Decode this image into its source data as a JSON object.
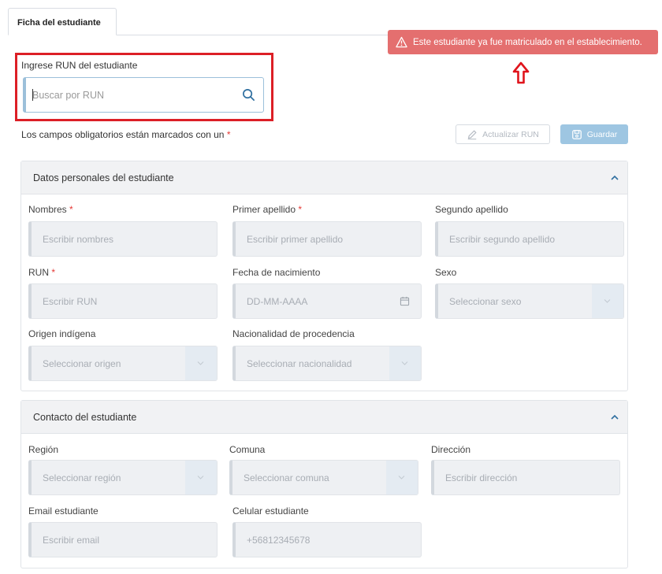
{
  "tab": {
    "label": "Ficha del estudiante"
  },
  "alert": {
    "message": "Este estudiante ya fue matriculado en el establecimiento."
  },
  "run_search": {
    "label": "Ingrese RUN del estudiante",
    "placeholder": "Buscar por RUN"
  },
  "required_note": {
    "text": "Los campos obligatorios están marcados con un",
    "asterisk": "*"
  },
  "actions": {
    "update_label": "Actualizar RUN",
    "save_label": "Guardar"
  },
  "personal": {
    "title": "Datos personales del estudiante",
    "nombres": {
      "label": "Nombres",
      "placeholder": "Escribir nombres"
    },
    "primer_apellido": {
      "label": "Primer apellido",
      "placeholder": "Escribir primer apellido"
    },
    "segundo_apellido": {
      "label": "Segundo apellido",
      "placeholder": "Escribir segundo apellido"
    },
    "run": {
      "label": "RUN",
      "placeholder": "Escribir RUN"
    },
    "fecha": {
      "label": "Fecha de nacimiento",
      "placeholder": "DD-MM-AAAA"
    },
    "sexo": {
      "label": "Sexo",
      "placeholder": "Seleccionar sexo"
    },
    "origen": {
      "label": "Origen indígena",
      "placeholder": "Seleccionar origen"
    },
    "nacionalidad": {
      "label": "Nacionalidad de procedencia",
      "placeholder": "Seleccionar nacionalidad"
    }
  },
  "contact": {
    "title": "Contacto del estudiante",
    "region": {
      "label": "Región",
      "placeholder": "Seleccionar región"
    },
    "comuna": {
      "label": "Comuna",
      "placeholder": "Seleccionar comuna"
    },
    "direccion": {
      "label": "Dirección",
      "placeholder": "Escribir dirección"
    },
    "email": {
      "label": "Email estudiante",
      "placeholder": "Escribir email"
    },
    "celular": {
      "label": "Celular estudiante",
      "placeholder": "+56812345678"
    }
  },
  "colors": {
    "alert": "#e46f6f",
    "highlight_border": "#dc1f26",
    "primary": "#9ec6e2",
    "required": "#e53935"
  }
}
